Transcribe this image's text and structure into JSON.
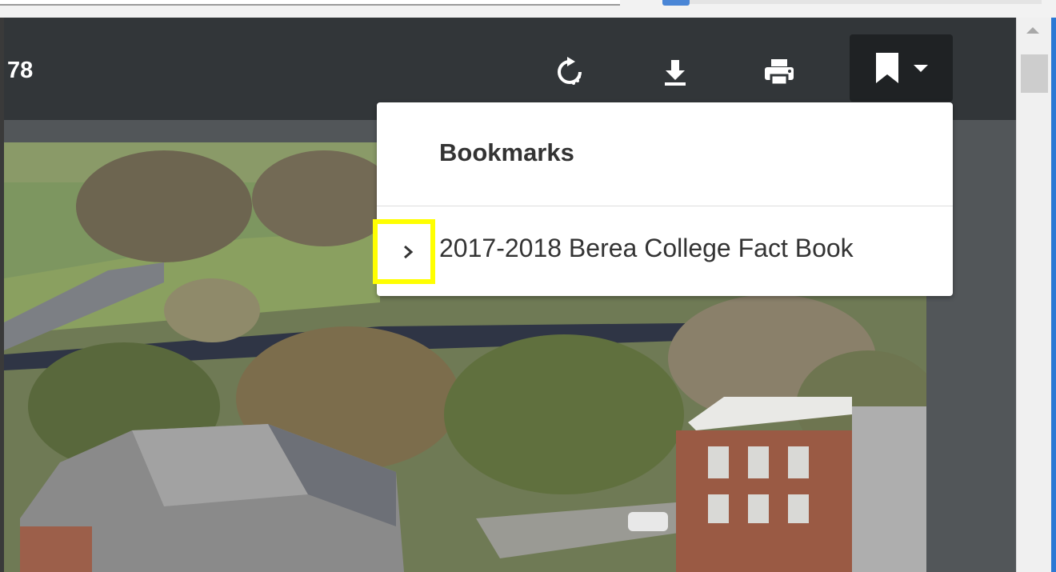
{
  "toolbar": {
    "page_number": "78",
    "icons": [
      "rotate-icon",
      "download-icon",
      "print-icon",
      "bookmark-icon",
      "caret-down-icon"
    ]
  },
  "bookmarks": {
    "heading": "Bookmarks",
    "items": [
      {
        "label": "2017-2018 Berea College Fact Book",
        "expander_icon": "chevron-right-icon"
      }
    ]
  },
  "colors": {
    "toolbar_bg": "#323639",
    "active_button_bg": "#1f2224",
    "highlight": "#ffff00",
    "panel_bg": "#ffffff"
  }
}
